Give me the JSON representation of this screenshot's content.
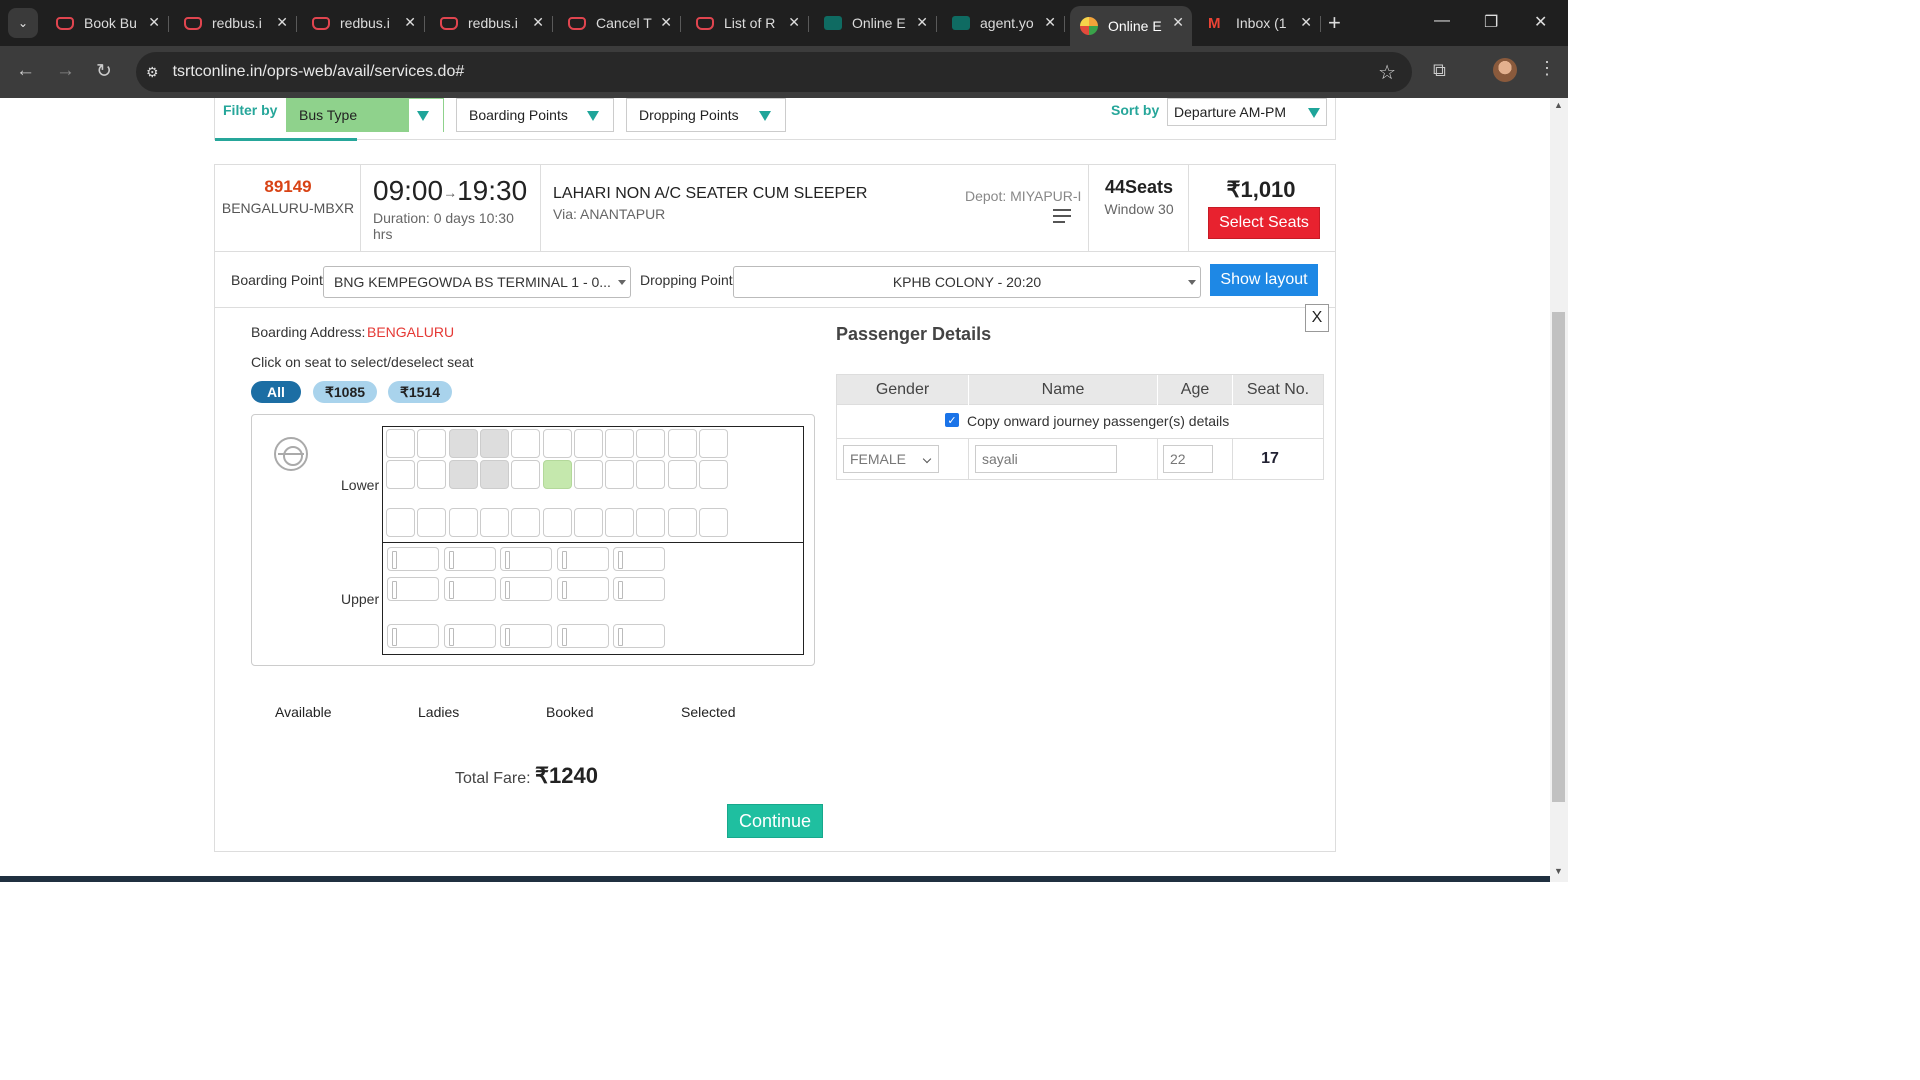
{
  "browser": {
    "tabs": [
      {
        "title": "Book Bu",
        "fav": "red"
      },
      {
        "title": "redbus.i",
        "fav": "red"
      },
      {
        "title": "redbus.i",
        "fav": "red"
      },
      {
        "title": "redbus.i",
        "fav": "red"
      },
      {
        "title": "Cancel T",
        "fav": "red"
      },
      {
        "title": "List of R",
        "fav": "red"
      },
      {
        "title": "Online E",
        "fav": "teal"
      },
      {
        "title": "agent.yo",
        "fav": "teal"
      },
      {
        "title": "Online E",
        "fav": "circ",
        "active": true
      },
      {
        "title": "Inbox (1",
        "fav": "gm"
      }
    ],
    "url": "tsrtconline.in/oprs-web/avail/services.do#"
  },
  "filter": {
    "label": "Filter by",
    "bus_type": "Bus Type",
    "boarding_points": "Boarding Points",
    "dropping_points": "Dropping Points",
    "sort_label": "Sort by",
    "sort_value": "Departure AM-PM"
  },
  "service": {
    "number": "89149",
    "code": "BENGALURU-MBXR",
    "departure": "09:00",
    "arrival": "19:30",
    "duration": "Duration: 0 days 10:30 hrs",
    "bus_type": "LAHARI NON A/C SEATER CUM SLEEPER",
    "via": "Via: ANANTAPUR",
    "depot": "Depot: MIYAPUR-I",
    "seats": "44Seats",
    "window": "Window 30",
    "price": "₹1,010",
    "select_label": "Select Seats"
  },
  "points": {
    "boarding_label": "Boarding Point",
    "boarding_value": "BNG KEMPEGOWDA BS TERMINAL 1 - 0...",
    "dropping_label": "Dropping Point",
    "dropping_value": "KPHB COLONY - 20:20",
    "show_layout": "Show layout"
  },
  "seatmap": {
    "close": "X",
    "boarding_address_label": "Boarding Address:",
    "boarding_address": "BENGALURU",
    "instruction": "Click on seat to select/deselect seat",
    "filters": [
      "All",
      "₹1085",
      "₹1514"
    ],
    "lower_label": "Lower",
    "upper_label": "Upper",
    "legend": [
      "Available",
      "Ladies",
      "Booked",
      "Selected"
    ],
    "total_label": "Total Fare:",
    "total_value": "₹1240",
    "continue": "Continue"
  },
  "passenger": {
    "title": "Passenger Details",
    "headers": [
      "Gender",
      "Name",
      "Age",
      "Seat No."
    ],
    "copy_label": "Copy onward journey passenger(s) details",
    "gender": "FEMALE",
    "name": "sayali",
    "age": "22",
    "seat": "17"
  }
}
